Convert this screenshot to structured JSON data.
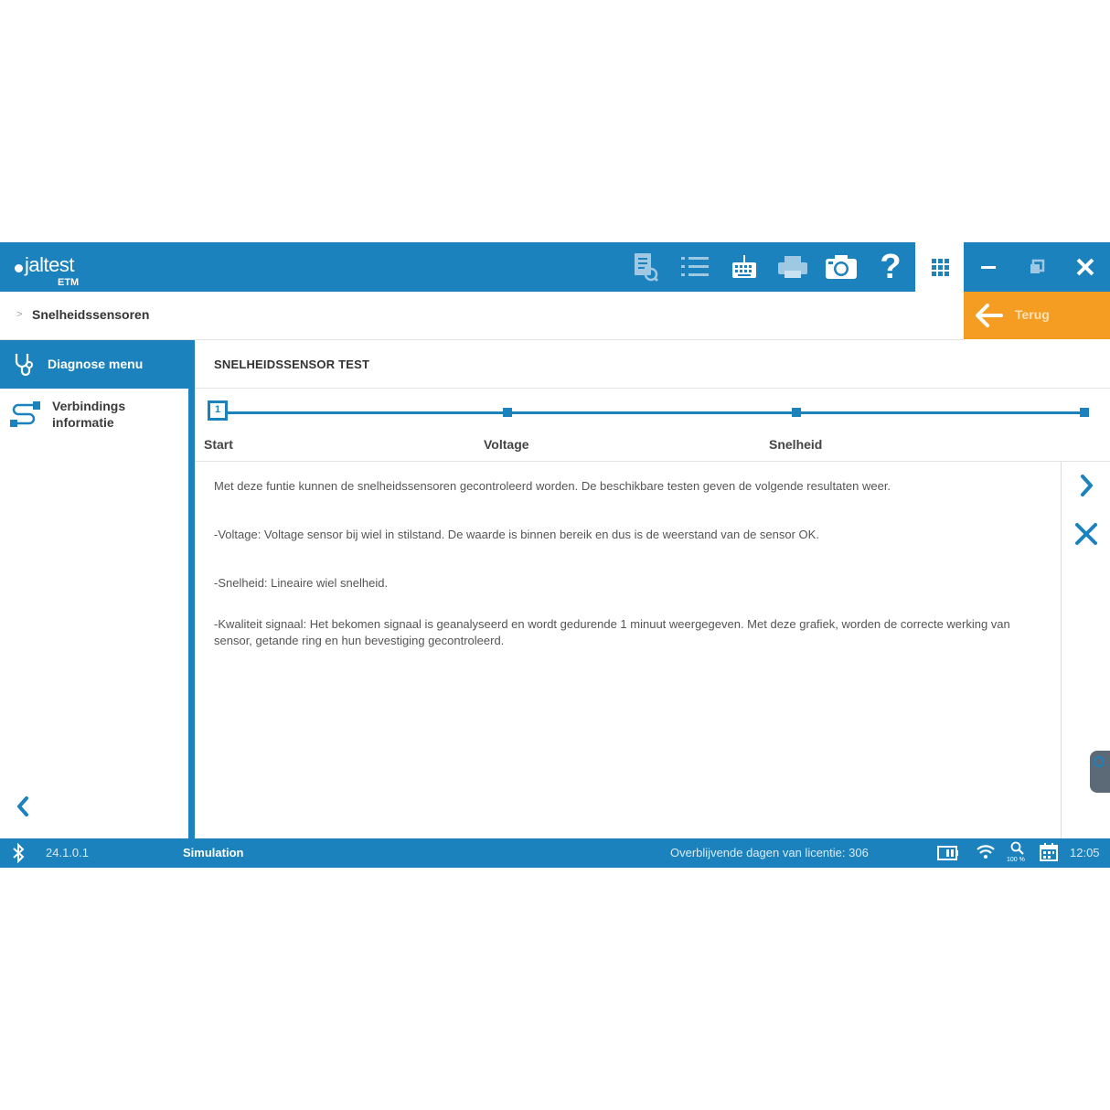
{
  "app": {
    "logo_name": "jaltest",
    "logo_sub": "ETM"
  },
  "toolbar": {
    "icons": [
      "document-search-icon",
      "list-icon",
      "keyboard-icon",
      "printer-icon",
      "camera-icon",
      "help-icon"
    ],
    "help_glyph": "?"
  },
  "window": {
    "controls": [
      "minimize-icon",
      "restore-icon",
      "close-icon"
    ]
  },
  "breadcrumb": {
    "current": "Snelheidssensoren"
  },
  "back_button": {
    "label": "Terug"
  },
  "sidebar": {
    "active_label": "Diagnose menu",
    "items": [
      {
        "label_line1": "Verbindings",
        "label_line2": "informatie"
      }
    ]
  },
  "main": {
    "title": "SNELHEIDSSENSOR TEST",
    "steps": [
      {
        "number": "1",
        "label": "Start"
      },
      {
        "label": "Voltage"
      },
      {
        "label": "Snelheid"
      },
      {
        "label": ""
      }
    ],
    "paragraphs": [
      "Met deze funtie kunnen de snelheidssensoren gecontroleerd worden. De beschikbare testen geven de volgende resultaten weer.",
      "-Voltage: Voltage sensor bij wiel in stilstand. De waarde is binnen bereik en dus is de weerstand van de sensor OK.",
      "-Snelheid: Lineaire wiel snelheid.",
      "-Kwaliteit signaal: Het bekomen signaal is geanalyseerd en wordt gedurende 1 minuut weergegeven. Met deze grafiek, worden de correcte werking van sensor, getande ring en hun bevestiging gecontroleerd."
    ]
  },
  "status": {
    "version": "24.1.0.1",
    "mode": "Simulation",
    "license": "Overblijvende dagen van licentie: 306",
    "zoom": "100 %",
    "time": "12:05"
  },
  "colors": {
    "primary": "#1b82bd",
    "accent": "#f59d22"
  }
}
